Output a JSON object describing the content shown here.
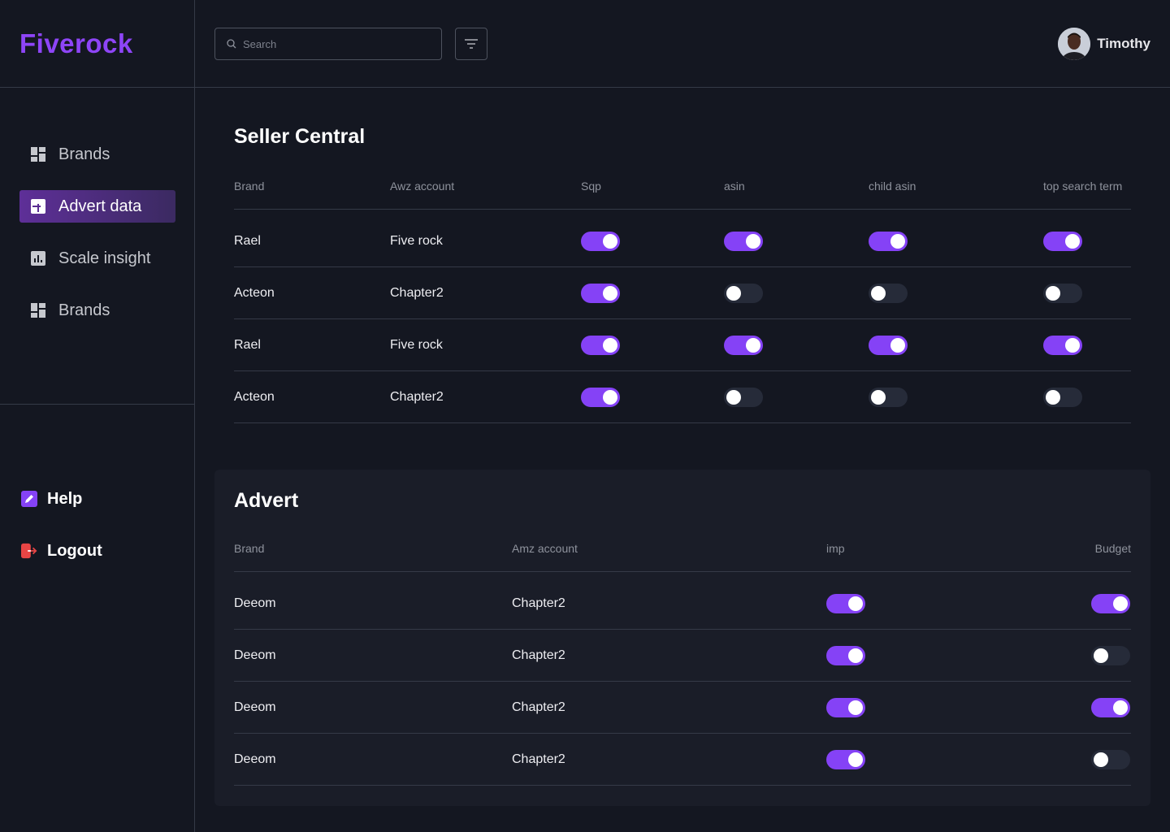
{
  "app": {
    "logo": "Fiverock"
  },
  "sidebar": {
    "items": [
      {
        "label": "Brands",
        "icon": "grid-icon",
        "active": false
      },
      {
        "label": "Advert data",
        "icon": "puzzle-icon",
        "active": true
      },
      {
        "label": "Scale insight",
        "icon": "chart-icon",
        "active": false
      },
      {
        "label": "Brands",
        "icon": "grid-icon",
        "active": false
      }
    ],
    "bottom": [
      {
        "label": "Help",
        "icon": "edit-icon",
        "color": "#8542f6"
      },
      {
        "label": "Logout",
        "icon": "logout-icon",
        "color": "#e84545"
      }
    ]
  },
  "header": {
    "search_placeholder": "Search",
    "user_name": "Timothy"
  },
  "seller_central": {
    "title": "Seller Central",
    "columns": [
      "Brand",
      "Awz account",
      "Sqp",
      "asin",
      "child asin",
      "top search term"
    ],
    "rows": [
      {
        "brand": "Rael",
        "account": "Five rock",
        "toggles": [
          true,
          true,
          true,
          true
        ]
      },
      {
        "brand": "Acteon",
        "account": "Chapter2",
        "toggles": [
          true,
          false,
          false,
          false
        ]
      },
      {
        "brand": "Rael",
        "account": "Five rock",
        "toggles": [
          true,
          true,
          true,
          true
        ]
      },
      {
        "brand": "Acteon",
        "account": "Chapter2",
        "toggles": [
          true,
          false,
          false,
          false
        ]
      }
    ]
  },
  "advert": {
    "title": "Advert",
    "columns": [
      "Brand",
      "Amz account",
      "imp",
      "Budget"
    ],
    "rows": [
      {
        "brand": "Deeom",
        "account": "Chapter2",
        "toggles": [
          true,
          true
        ]
      },
      {
        "brand": "Deeom",
        "account": "Chapter2",
        "toggles": [
          true,
          false
        ]
      },
      {
        "brand": "Deeom",
        "account": "Chapter2",
        "toggles": [
          true,
          true
        ]
      },
      {
        "brand": "Deeom",
        "account": "Chapter2",
        "toggles": [
          true,
          false
        ]
      }
    ]
  },
  "colors": {
    "accent": "#8542f6",
    "background": "#141721",
    "card": "#1a1d28",
    "toggle_off": "#262b39"
  }
}
